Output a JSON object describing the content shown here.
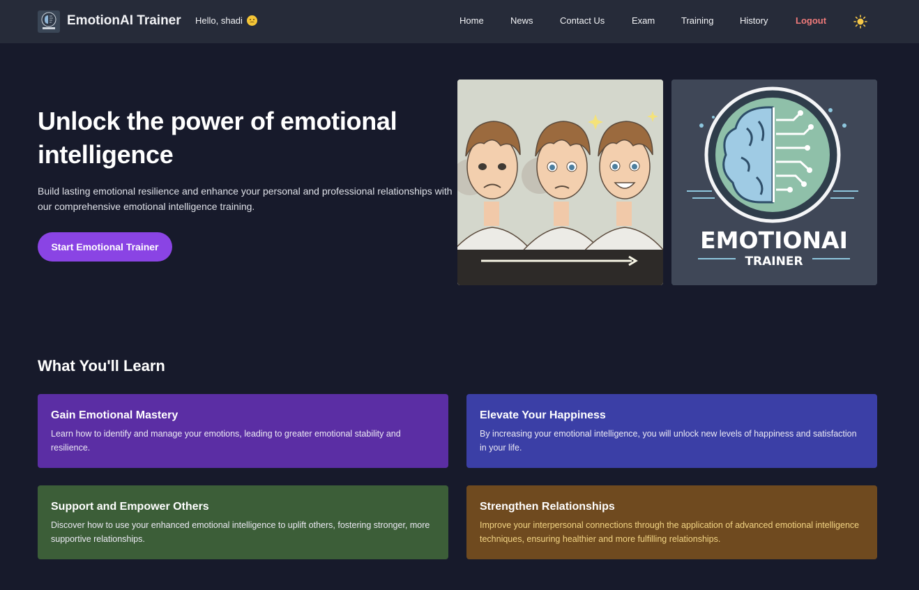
{
  "navbar": {
    "brand": "EmotionAI Trainer",
    "greeting": "Hello, shadi",
    "links": [
      "Home",
      "News",
      "Contact Us",
      "Exam",
      "Training",
      "History"
    ],
    "logout": "Logout",
    "theme_icon": "sun-icon"
  },
  "hero": {
    "title": "Unlock the power of emotional intelligence",
    "description": "Build lasting emotional resilience and enhance your personal and professional relationships with our comprehensive emotional intelligence training.",
    "cta": "Start Emotional Trainer",
    "logo_text_main": "EMOTIONAI",
    "logo_text_sub": "TRAINER"
  },
  "learn": {
    "heading": "What You'll Learn",
    "cards": [
      {
        "title": "Gain Emotional Mastery",
        "text": "Learn how to identify and manage your emotions, leading to greater emotional stability and resilience.",
        "color": "#5b2ea4"
      },
      {
        "title": "Elevate Your Happiness",
        "text": "By increasing your emotional intelligence, you will unlock new levels of happiness and satisfaction in your life.",
        "color": "#3b3fa6"
      },
      {
        "title": "Support and Empower Others",
        "text": "Discover how to use your enhanced emotional intelligence to uplift others, fostering stronger, more supportive relationships.",
        "color": "#3c5e38"
      },
      {
        "title": "Strengthen Relationships",
        "text": "Improve your interpersonal connections through the application of advanced emotional intelligence techniques, ensuring healthier and more fulfilling relationships.",
        "color": "#6f4a1f"
      }
    ]
  },
  "colors": {
    "page_bg": "#171a2b",
    "navbar_bg": "#262b39",
    "accent": "#8a44e4",
    "logout": "#ef7a7a"
  }
}
